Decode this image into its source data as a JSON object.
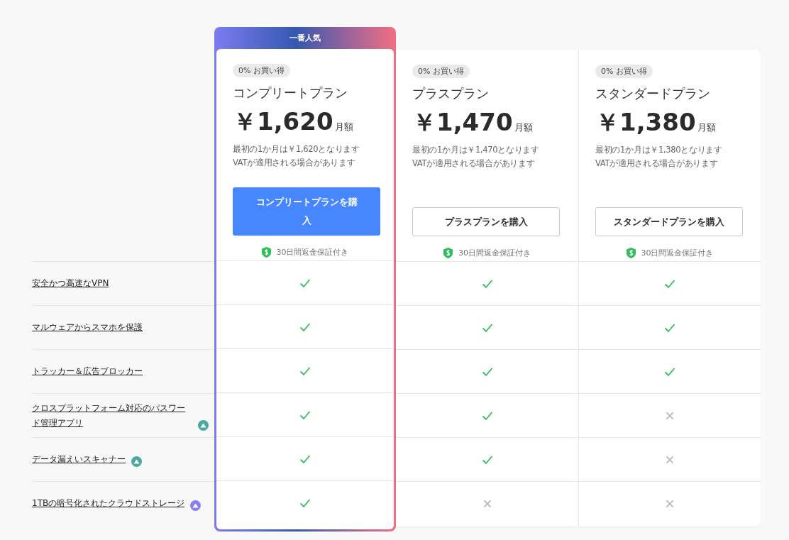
{
  "popular_badge": "一番人気",
  "features": [
    {
      "label": "安全かつ高速なVPN"
    },
    {
      "label": "マルウェアからスマホを保護"
    },
    {
      "label": "トラッカー＆広告ブロッカー"
    },
    {
      "label": "クロスプラットフォーム対応のパスワード管理アプリ",
      "color": "#4aa8a0"
    },
    {
      "label": "データ漏えいスキャナー",
      "color": "#4aa8a0"
    },
    {
      "label": "1TBの暗号化されたクラウドストレージ",
      "color": "#8a7ff0"
    }
  ],
  "plans": [
    {
      "highlighted": true,
      "discount": "0% お買い得",
      "name": "コンプリートプラン",
      "price": "￥1,620",
      "period": "月額",
      "note_1": "最初の1か月は￥1,620となります",
      "note_2": "VATが適用される場合があります",
      "button": "コンプリートプランを購入",
      "guarantee": "30日間返金保証付き",
      "included": [
        true,
        true,
        true,
        true,
        true,
        true
      ]
    },
    {
      "highlighted": false,
      "discount": "0% お買い得",
      "name": "プラスプラン",
      "price": "￥1,470",
      "period": "月額",
      "note_1": "最初の1か月は￥1,470となります",
      "note_2": "VATが適用される場合があります",
      "button": "プラスプランを購入",
      "guarantee": "30日間返金保証付き",
      "included": [
        true,
        true,
        true,
        true,
        true,
        false
      ]
    },
    {
      "highlighted": false,
      "discount": "0% お買い得",
      "name": "スタンダードプラン",
      "price": "￥1,380",
      "period": "月額",
      "note_1": "最初の1か月は￥1,380となります",
      "note_2": "VATが適用される場合があります",
      "button": "スタンダードプランを購入",
      "guarantee": "30日間返金保証付き",
      "included": [
        true,
        true,
        true,
        false,
        false,
        false
      ]
    }
  ]
}
